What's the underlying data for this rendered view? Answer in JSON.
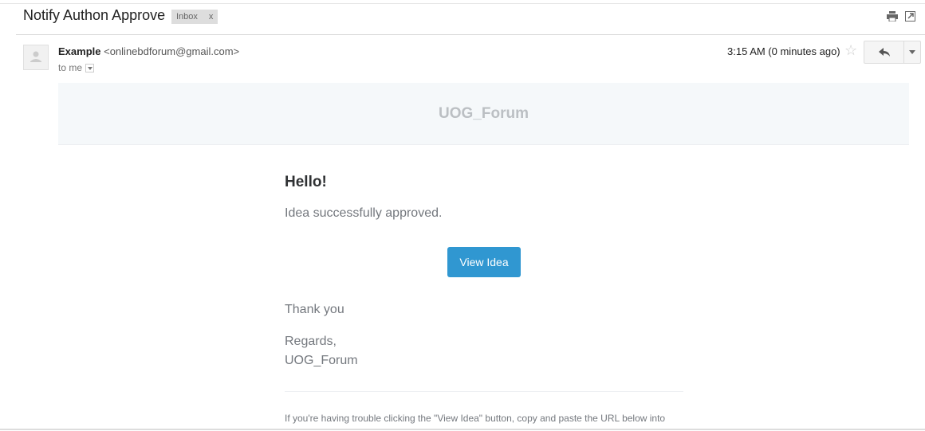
{
  "email": {
    "subject": "Notify Authon Approve",
    "label": "Inbox",
    "label_remove": "x",
    "sender_name": "Example",
    "sender_email": "<onlinebdforum@gmail.com>",
    "recipient": "to me",
    "time": "3:15 AM (0 minutes ago)"
  },
  "body": {
    "brand": "UOG_Forum",
    "greeting": "Hello!",
    "message": "Idea successfully approved.",
    "button": "View Idea",
    "thanks": "Thank you",
    "regards": "Regards,",
    "signature": "UOG_Forum",
    "footer": "If you're having trouble clicking the \"View Idea\" button, copy and paste the URL below into"
  },
  "colors": {
    "button": "#3097d1",
    "banner": "#f5f8fa"
  }
}
